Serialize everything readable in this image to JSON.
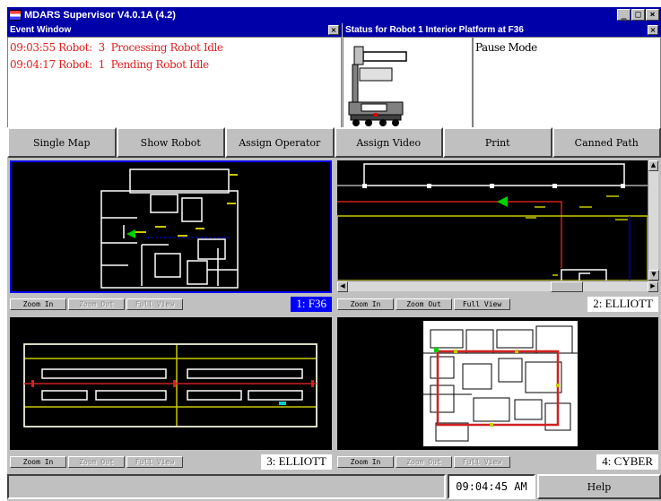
{
  "window": {
    "title": "MDARS Supervisor V4.0.1A (4.2)",
    "min_glyph": "_",
    "max_glyph": "□",
    "close_glyph": "×"
  },
  "event_pane": {
    "title": "Event Window",
    "close_glyph": "×",
    "lines": [
      "09:03:55 Robot:  3  Processing Robot Idle",
      "09:04:17 Robot:  1  Pending Robot Idle"
    ]
  },
  "status_pane": {
    "title": "Status for Robot  1 Interior Platform at F36",
    "close_glyph": "×",
    "mode": "Pause Mode"
  },
  "buttons": {
    "single_map": "Single Map",
    "show_robot": "Show Robot",
    "assign_operator": "Assign Operator",
    "assign_video": "Assign Video",
    "print": "Print",
    "canned_path": "Canned Path"
  },
  "maps": [
    {
      "label": "1: F36",
      "zoom_in": "Zoom In",
      "zoom_out": "Zoom Out",
      "full_view": "Full View",
      "zoom_out_enabled": false,
      "full_view_enabled": false,
      "selected": true
    },
    {
      "label": "2: ELLIOTT",
      "zoom_in": "Zoom In",
      "zoom_out": "Zoom Out",
      "full_view": "Full View",
      "zoom_out_enabled": true,
      "full_view_enabled": true,
      "selected": false
    },
    {
      "label": "3: ELLIOTT",
      "zoom_in": "Zoom In",
      "zoom_out": "Zoom Out",
      "full_view": "Full View",
      "zoom_out_enabled": false,
      "full_view_enabled": false,
      "selected": false
    },
    {
      "label": "4: CYBER",
      "zoom_in": "Zoom In",
      "zoom_out": "Zoom Out",
      "full_view": "Full View",
      "zoom_out_enabled": false,
      "full_view_enabled": false,
      "selected": false
    }
  ],
  "statusbar": {
    "message": "",
    "clock": "09:04:45 AM",
    "help": "Help"
  },
  "colors": {
    "title_bar": "#0000a8",
    "event_text": "#e02020",
    "map_background": "#000000",
    "map_walls": "#ffffff",
    "map_path": "#c8c800",
    "map_route": "#d02020",
    "robot_marker": "#00d000"
  },
  "icons": [
    "app-icon",
    "minimize-icon",
    "maximize-icon",
    "close-icon",
    "robot-icon",
    "scroll-up-icon",
    "scroll-down-icon",
    "scroll-left-icon",
    "scroll-right-icon"
  ]
}
